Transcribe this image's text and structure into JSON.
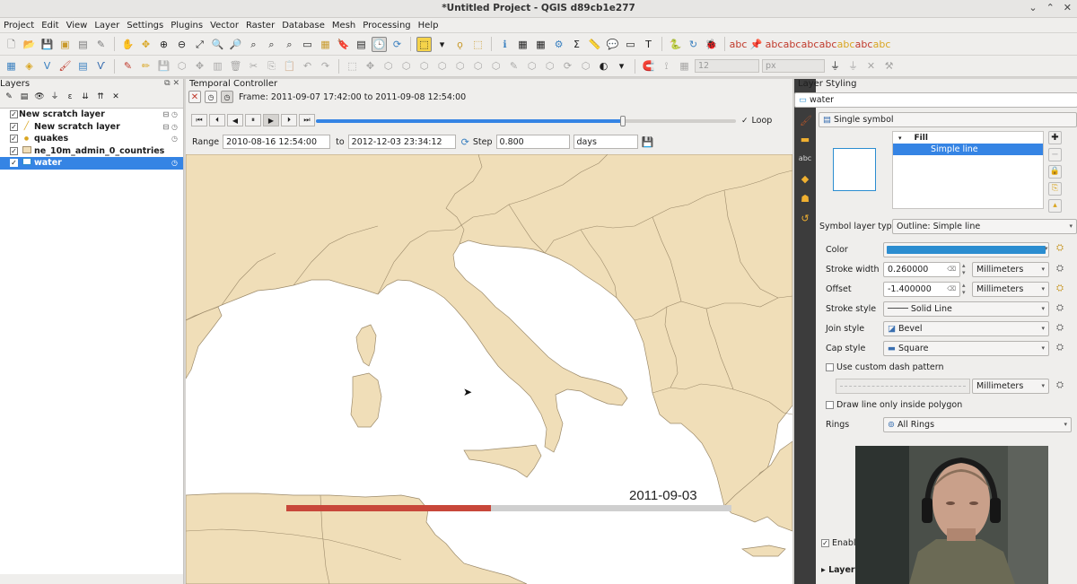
{
  "window": {
    "title": "*Untitled Project - QGIS d89cb1e277",
    "buttons": [
      "⌄",
      "⌃",
      "✕"
    ]
  },
  "menu": [
    "Project",
    "Edit",
    "View",
    "Layer",
    "Settings",
    "Plugins",
    "Vector",
    "Raster",
    "Database",
    "Mesh",
    "Processing",
    "Help"
  ],
  "toolbar2": {
    "font_size": "12",
    "unit": "px"
  },
  "layers_panel": {
    "title": "Layers",
    "items": [
      {
        "label": "New scratch layer",
        "checked": true,
        "symbol": "⊞"
      },
      {
        "label": "New scratch layer",
        "checked": true,
        "symbol": "╱"
      },
      {
        "label": "quakes",
        "checked": true,
        "symbol": "●"
      },
      {
        "label": "ne_10m_admin_0_countries",
        "checked": true,
        "symbol": "▭"
      },
      {
        "label": "water",
        "checked": true,
        "symbol": "▭",
        "selected": true
      }
    ]
  },
  "temporal": {
    "title": "Temporal Controller",
    "frame": "Frame: 2011-09-07 17:42:00 to 2011-09-08 12:54:00",
    "loop_label": "Loop",
    "loop_checked": true,
    "slider_position": 0.73,
    "range_label": "Range",
    "range_from": "2010-08-16 12:54:00",
    "to_label": "to",
    "range_to": "2012-12-03 23:34:12",
    "step_label": "Step",
    "step_value": "0.800",
    "step_unit": "days"
  },
  "map": {
    "date_label": "2011-09-03",
    "progress": 0.46,
    "colors": {
      "land": "#f0deb8",
      "water": "#ffffff",
      "border": "#9c8a6a",
      "progress_fill": "#c8473a",
      "progress_track": "#cfcfcf"
    }
  },
  "styling": {
    "title": "Layer Styling",
    "layer": "water",
    "renderer": "Single symbol",
    "tree": {
      "root": "Fill",
      "child": "Simple line"
    },
    "symbol_layer_type_label": "Symbol layer type",
    "symbol_layer_type": "Outline: Simple line",
    "color_label": "Color",
    "color_value": "#2b8dd0",
    "stroke_width_label": "Stroke width",
    "stroke_width": "0.260000",
    "stroke_width_unit": "Millimeters",
    "offset_label": "Offset",
    "offset": "-1.400000",
    "offset_unit": "Millimeters",
    "stroke_style_label": "Stroke style",
    "stroke_style": "Solid Line",
    "join_style_label": "Join style",
    "join_style": "Bevel",
    "cap_style_label": "Cap style",
    "cap_style": "Square",
    "custom_dash_label": "Use custom dash pattern",
    "dash_unit": "Millimeters",
    "draw_inside_label": "Draw line only inside polygon",
    "rings_label": "Rings",
    "rings": "All Rings",
    "enable_label": "Enabl",
    "layer_section": "Layer"
  }
}
